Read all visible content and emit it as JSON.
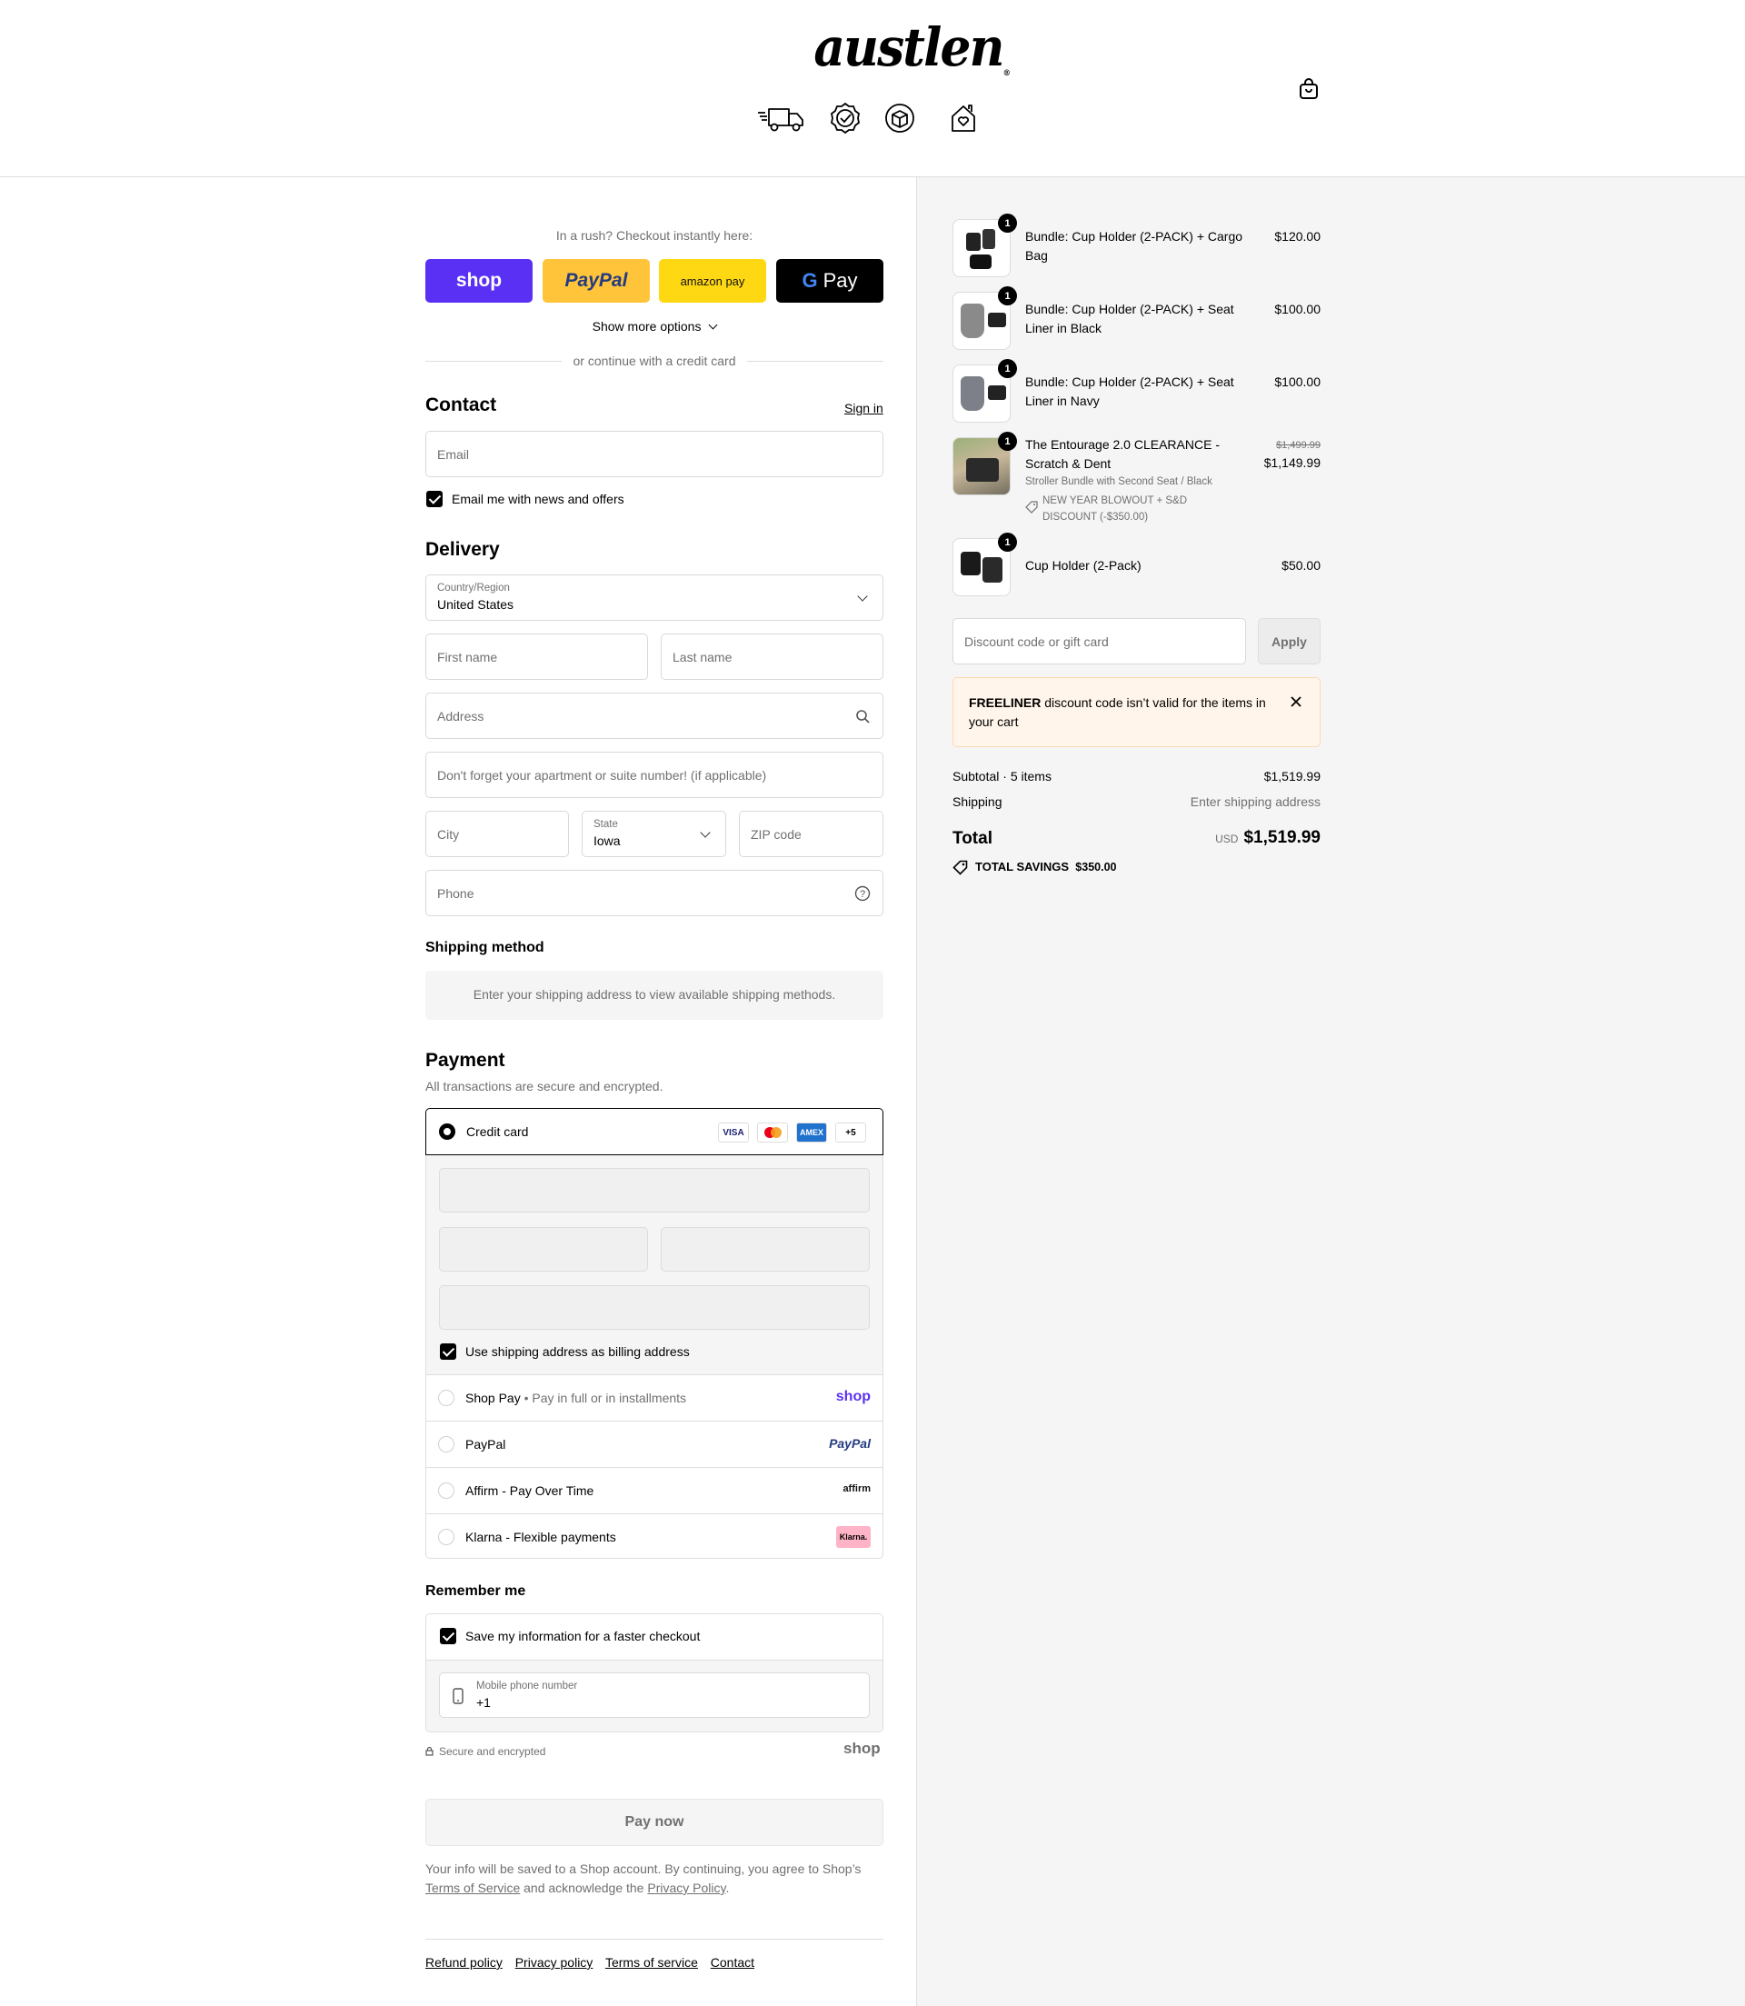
{
  "brand": {
    "logo_text": "austlen"
  },
  "header": {
    "icons": [
      "fast-delivery-truck-icon",
      "verified-badge-icon",
      "box-icon",
      "home-heart-icon"
    ],
    "cart_icon": "shopping-bag-icon"
  },
  "express": {
    "prompt": "In a rush? Checkout instantly here:",
    "shop_label": "shop",
    "paypal_label": "PayPal",
    "amazon_label": "amazon pay",
    "gpay_label": "Pay",
    "gpay_g": "G",
    "more_options": "Show more options",
    "divider_text": "or continue with a credit card"
  },
  "contact": {
    "heading": "Contact",
    "sign_in": "Sign in",
    "email_placeholder": "Email",
    "newsletter_label": "Email me with news and offers"
  },
  "delivery": {
    "heading": "Delivery",
    "country_label": "Country/Region",
    "country_value": "United States",
    "first_name_placeholder": "First name",
    "last_name_placeholder": "Last name",
    "address_placeholder": "Address",
    "apartment_placeholder": "Don't forget your apartment or suite number! (if applicable)",
    "city_placeholder": "City",
    "state_label": "State",
    "state_value": "Iowa",
    "zip_placeholder": "ZIP code",
    "phone_placeholder": "Phone"
  },
  "shipping_method": {
    "heading": "Shipping method",
    "notice": "Enter your shipping address to view available shipping methods."
  },
  "payment": {
    "heading": "Payment",
    "subheading": "All transactions are secure and encrypted.",
    "credit_card_label": "Credit card",
    "card_badges": [
      "VISA",
      "mastercard",
      "AMEX",
      "+5"
    ],
    "billing_same_label": "Use shipping address as billing address",
    "shop_pay_label": "Shop Pay",
    "shop_pay_sep": "•",
    "shop_pay_sub": "Pay in full or in installments",
    "shop_pay_logo": "shop",
    "paypal_label": "PayPal",
    "paypal_logo": "PayPal",
    "affirm_label": "Affirm - Pay Over Time",
    "affirm_logo": "affirm",
    "klarna_label": "Klarna - Flexible payments",
    "klarna_logo": "Klarna."
  },
  "remember": {
    "heading": "Remember me",
    "save_label": "Save my information for a faster checkout",
    "mobile_label": "Mobile phone number",
    "mobile_value": "+1",
    "secure_text": "Secure and encrypted",
    "shop_logo": "shop"
  },
  "pay_now": "Pay now",
  "legal": {
    "text_1": "Your info will be saved to a Shop account. By continuing, you agree to Shop’s",
    "terms": "Terms of Service",
    "text_2": "and acknowledge the",
    "privacy": "Privacy Policy",
    "text_3": "."
  },
  "footer_links": [
    "Refund policy",
    "Privacy policy",
    "Terms of service",
    "Contact"
  ],
  "cart": {
    "items": [
      {
        "qty": "1",
        "title": "Bundle: Cup Holder (2-PACK) + Cargo Bag",
        "price": "$120.00"
      },
      {
        "qty": "1",
        "title": "Bundle: Cup Holder (2-PACK) + Seat Liner in Black",
        "price": "$100.00"
      },
      {
        "qty": "1",
        "title": "Bundle: Cup Holder (2-PACK) + Seat Liner in Navy",
        "price": "$100.00"
      },
      {
        "qty": "1",
        "title": "The Entourage 2.0 CLEARANCE - Scratch & Dent",
        "variant": "Stroller Bundle with Second Seat / Black",
        "discount": "NEW YEAR BLOWOUT + S&D DISCOUNT (-$350.00)",
        "original_price": "$1,499.99",
        "price": "$1,149.99"
      },
      {
        "qty": "1",
        "title": "Cup Holder (2-Pack)",
        "price": "$50.00"
      }
    ],
    "discount_placeholder": "Discount code or gift card",
    "apply": "Apply",
    "alert_code": "FREELINER",
    "alert_text": "discount code isn’t valid for the items in your cart",
    "subtotal_label": "Subtotal · 5 items",
    "subtotal_value": "$1,519.99",
    "shipping_label": "Shipping",
    "shipping_value": "Enter shipping address",
    "total_label": "Total",
    "currency": "USD",
    "total_value": "$1,519.99",
    "savings_label": "TOTAL SAVINGS",
    "savings_value": "$350.00"
  },
  "colors": {
    "shop_purple": "#5a31f4",
    "paypal_yellow": "#ffc439",
    "amazon_yellow": "#ffd814",
    "alert_bg": "#fff5ea",
    "summary_bg": "#f5f5f5"
  }
}
